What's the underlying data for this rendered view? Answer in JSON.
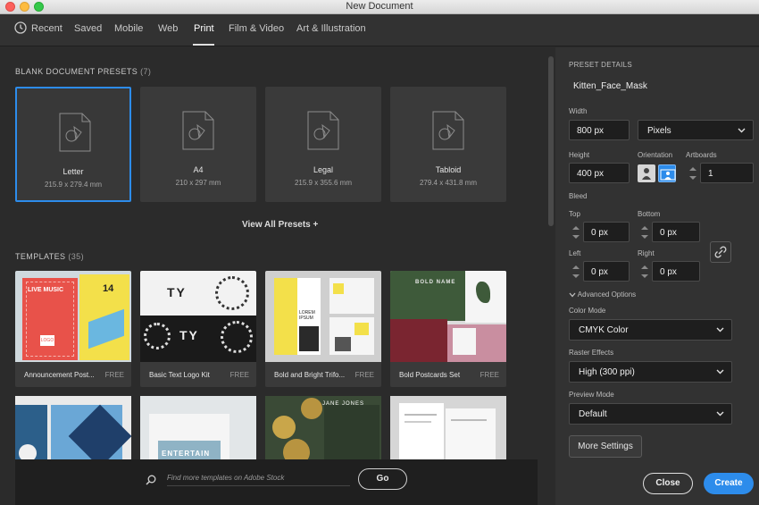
{
  "window": {
    "title": "New Document"
  },
  "tabs": [
    {
      "label": "Recent"
    },
    {
      "label": "Saved"
    },
    {
      "label": "Mobile"
    },
    {
      "label": "Web"
    },
    {
      "label": "Print"
    },
    {
      "label": "Film & Video"
    },
    {
      "label": "Art & Illustration"
    }
  ],
  "active_tab": "Print",
  "presets_section": {
    "label": "BLANK DOCUMENT PRESETS",
    "count": "(7)"
  },
  "presets": [
    {
      "name": "Letter",
      "dims": "215.9 x 279.4 mm"
    },
    {
      "name": "A4",
      "dims": "210 x 297 mm"
    },
    {
      "name": "Legal",
      "dims": "215.9 x 355.6 mm"
    },
    {
      "name": "Tabloid",
      "dims": "279.4 x 431.8 mm"
    }
  ],
  "view_all": "View All Presets +",
  "templates_section": {
    "label": "TEMPLATES",
    "count": "(35)"
  },
  "templates": [
    {
      "name": "Announcement Post...",
      "badge": "FREE",
      "thumb_text": "LIVE MUSIC",
      "thumb_text2": "14",
      "thumb_text3": "LOGO"
    },
    {
      "name": "Basic Text Logo Kit",
      "badge": "FREE",
      "thumb_text": "TY",
      "thumb_text2": "TY"
    },
    {
      "name": "Bold and Bright Trifo...",
      "badge": "FREE",
      "thumb_text": "LOREM IPSUM"
    },
    {
      "name": "Bold Postcards Set",
      "badge": "FREE",
      "thumb_text": "BOLD NAME"
    }
  ],
  "templates_row2": [
    {
      "thumb_text": ""
    },
    {
      "thumb_text": "ENTERTAIN"
    },
    {
      "thumb_text": "JANE JONES"
    },
    {
      "thumb_text": ""
    }
  ],
  "search": {
    "placeholder": "Find more templates on Adobe Stock",
    "go_label": "Go"
  },
  "details": {
    "heading": "PRESET DETAILS",
    "doc_name": "Kitten_Face_Mask",
    "width_label": "Width",
    "width_value": "800 px",
    "units_value": "Pixels",
    "height_label": "Height",
    "height_value": "400 px",
    "orientation_label": "Orientation",
    "artboards_label": "Artboards",
    "artboards_value": "1",
    "bleed_label": "Bleed",
    "top_label": "Top",
    "top_value": "0 px",
    "bottom_label": "Bottom",
    "bottom_value": "0 px",
    "left_label": "Left",
    "left_value": "0 px",
    "right_label": "Right",
    "right_value": "0 px",
    "advanced_label": "Advanced Options",
    "color_mode_label": "Color Mode",
    "color_mode_value": "CMYK Color",
    "raster_label": "Raster Effects",
    "raster_value": "High (300 ppi)",
    "preview_label": "Preview Mode",
    "preview_value": "Default",
    "more_settings": "More Settings",
    "close_label": "Close",
    "create_label": "Create"
  },
  "colors": {
    "accent": "#2d8ceb",
    "bg": "#2b2b2b",
    "panel": "#323232"
  }
}
